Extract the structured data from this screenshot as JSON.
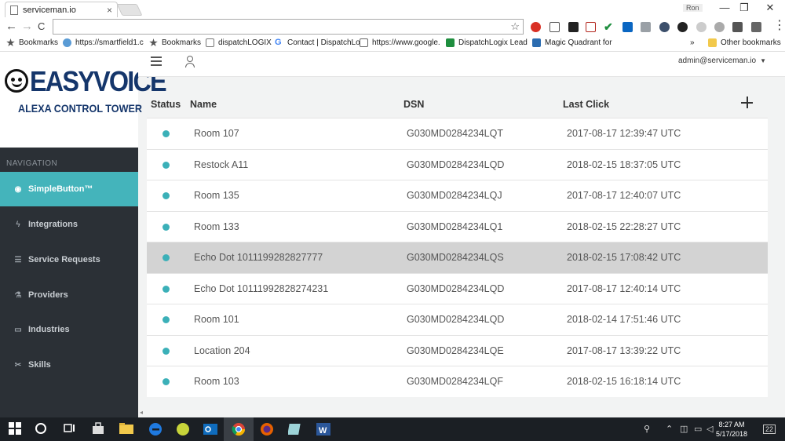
{
  "browser": {
    "tab_title": "serviceman.io",
    "tab_close": "×",
    "windows_user": "Ron",
    "window_controls": {
      "minimize": "—",
      "restore": "❐",
      "close": "✕"
    },
    "nav": {
      "back": "←",
      "forward": "→",
      "reload": "C"
    },
    "url_value": "",
    "star": "☆",
    "menu": "⋮",
    "bookmarks": [
      {
        "label": "Bookmarks",
        "icon": "star-icon",
        "color": "#555555"
      },
      {
        "label": "https://smartfield1.c",
        "icon": "cloud-icon",
        "color": "#5a9bd5"
      },
      {
        "label": "Bookmarks",
        "icon": "star-icon",
        "color": "#555555"
      },
      {
        "label": "dispatchLOGIX",
        "icon": "image-icon",
        "color": "#7a7a7a"
      },
      {
        "label": "Contact | DispatchLo",
        "icon": "google-icon",
        "color": "#4285f4"
      },
      {
        "label": "https://www.google.",
        "icon": "printer-icon",
        "color": "#666666"
      },
      {
        "label": "DispatchLogix Lead",
        "icon": "sheet-icon",
        "color": "#1e8e3e"
      },
      {
        "label": "Magic Quadrant for",
        "icon": "doc-icon",
        "color": "#2b6cb0"
      }
    ],
    "bookmarks_more": "»",
    "other_bookmarks": "Other bookmarks"
  },
  "brand": {
    "logo_text": "EASYVOICE",
    "subtitle": "ALEXA CONTROL TOWER"
  },
  "sidebar": {
    "heading": "NAVIGATION",
    "items": [
      {
        "label": "SimpleButton™",
        "icon": "circle-icon",
        "glyph": "◉",
        "active": true
      },
      {
        "label": "Integrations",
        "icon": "plug-icon",
        "glyph": "ϟ",
        "active": false
      },
      {
        "label": "Service Requests",
        "icon": "database-icon",
        "glyph": "☰",
        "active": false
      },
      {
        "label": "Providers",
        "icon": "flask-icon",
        "glyph": "⚗",
        "active": false
      },
      {
        "label": "Industries",
        "icon": "briefcase-icon",
        "glyph": "▭",
        "active": false
      },
      {
        "label": "Skills",
        "icon": "tools-icon",
        "glyph": "✂",
        "active": false
      }
    ]
  },
  "topbar": {
    "user_email": "admin@serviceman.io",
    "caret": "▼"
  },
  "table": {
    "columns": {
      "status": "Status",
      "name": "Name",
      "dsn": "DSN",
      "last_click": "Last Click"
    },
    "status_color": "#3bb0b8",
    "rows": [
      {
        "name": "Room 107",
        "dsn": "G030MD0284234LQT",
        "last_click": "2017-08-17 12:39:47 UTC",
        "highlighted": false
      },
      {
        "name": "Restock A11",
        "dsn": "G030MD0284234LQD",
        "last_click": "2018-02-15 18:37:05 UTC",
        "highlighted": false
      },
      {
        "name": "Room 135",
        "dsn": "G030MD0284234LQJ",
        "last_click": "2017-08-17 12:40:07 UTC",
        "highlighted": false
      },
      {
        "name": "Room 133",
        "dsn": "G030MD0284234LQ1",
        "last_click": "2018-02-15 22:28:27 UTC",
        "highlighted": false
      },
      {
        "name": "Echo Dot 1011199282827777",
        "dsn": "G030MD0284234LQS",
        "last_click": "2018-02-15 17:08:42 UTC",
        "highlighted": true
      },
      {
        "name": "Echo Dot 10111992828274231",
        "dsn": "G030MD0284234LQD",
        "last_click": "2017-08-17 12:40:14 UTC",
        "highlighted": false
      },
      {
        "name": "Room 101",
        "dsn": "G030MD0284234LQD",
        "last_click": "2018-02-14 17:51:46 UTC",
        "highlighted": false
      },
      {
        "name": "Location 204",
        "dsn": "G030MD0284234LQE",
        "last_click": "2017-08-17 13:39:22 UTC",
        "highlighted": false
      },
      {
        "name": "Room 103",
        "dsn": "G030MD0284234LQF",
        "last_click": "2018-02-15 16:18:14 UTC",
        "highlighted": false
      }
    ]
  },
  "taskbar": {
    "time": "8:27 AM",
    "date": "5/17/2018",
    "notification_count": "22"
  },
  "colors": {
    "accent": "#44b4bb",
    "sidebar_bg": "#2b3036",
    "brand_blue": "#15366b",
    "row_highlight": "#d3d3d3"
  }
}
